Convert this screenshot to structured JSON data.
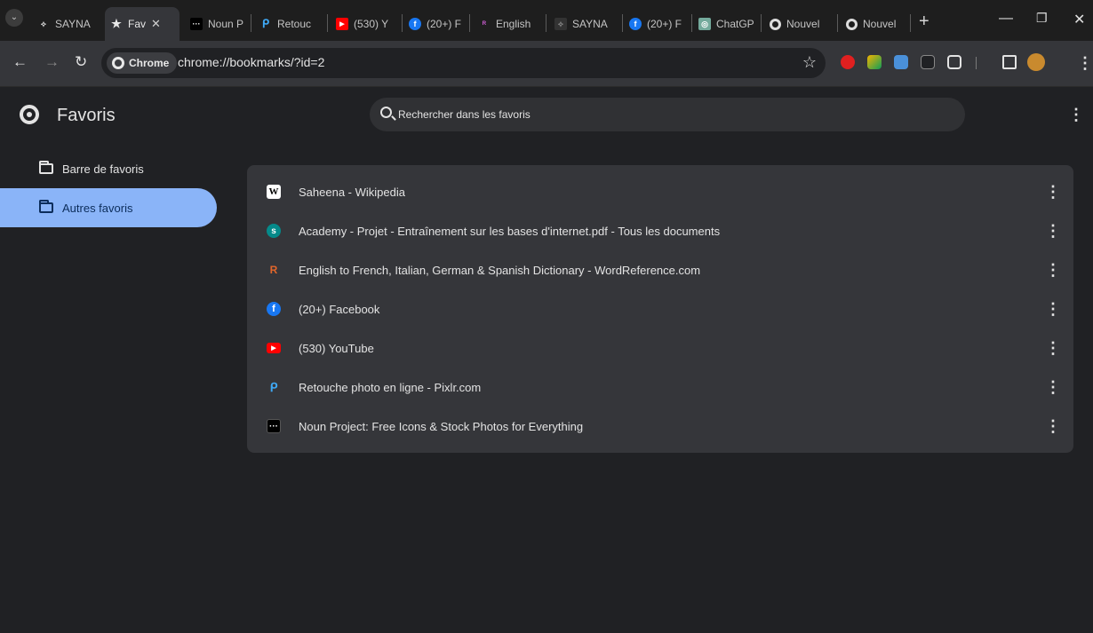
{
  "tabs": [
    {
      "label": "SAYNA",
      "icon": "sayna-icon"
    },
    {
      "label": "Fav",
      "icon": "star-icon",
      "active": true
    },
    {
      "label": "Noun P",
      "icon": "noun-project-icon"
    },
    {
      "label": "Retouc",
      "icon": "pixlr-icon"
    },
    {
      "label": "(530) Y",
      "icon": "youtube-icon"
    },
    {
      "label": "(20+) F",
      "icon": "facebook-icon"
    },
    {
      "label": "English",
      "icon": "wordreference-icon"
    },
    {
      "label": "SAYNA",
      "icon": "sayna-icon"
    },
    {
      "label": "(20+) F",
      "icon": "facebook-icon"
    },
    {
      "label": "ChatGP",
      "icon": "chatgpt-icon"
    },
    {
      "label": "Nouvel",
      "icon": "chrome-icon"
    },
    {
      "label": "Nouvel",
      "icon": "chrome-icon"
    }
  ],
  "toolbar": {
    "chip_label": "Chrome",
    "url": "chrome://bookmarks/?id=2"
  },
  "page": {
    "title": "Favoris",
    "search_placeholder": "Rechercher dans les favoris"
  },
  "folders": [
    {
      "label": "Barre de favoris",
      "selected": false
    },
    {
      "label": "Autres favoris",
      "selected": true
    }
  ],
  "bookmarks": [
    {
      "title": "Saheena - Wikipedia",
      "icon": "wikipedia-icon"
    },
    {
      "title": "Academy - Projet - Entraînement sur les bases d'internet.pdf - Tous les documents",
      "icon": "sharepoint-icon"
    },
    {
      "title": "English to French, Italian, German & Spanish Dictionary - WordReference.com",
      "icon": "wordreference-icon"
    },
    {
      "title": "(20+) Facebook",
      "icon": "facebook-icon"
    },
    {
      "title": "(530) YouTube",
      "icon": "youtube-icon"
    },
    {
      "title": "Retouche photo en ligne - Pixlr.com",
      "icon": "pixlr-icon"
    },
    {
      "title": "Noun Project: Free Icons & Stock Photos for Everything",
      "icon": "noun-project-icon"
    }
  ],
  "colors": {
    "accent": "#8ab4f8",
    "youtube": "#ff0000",
    "facebook": "#1877f2"
  }
}
